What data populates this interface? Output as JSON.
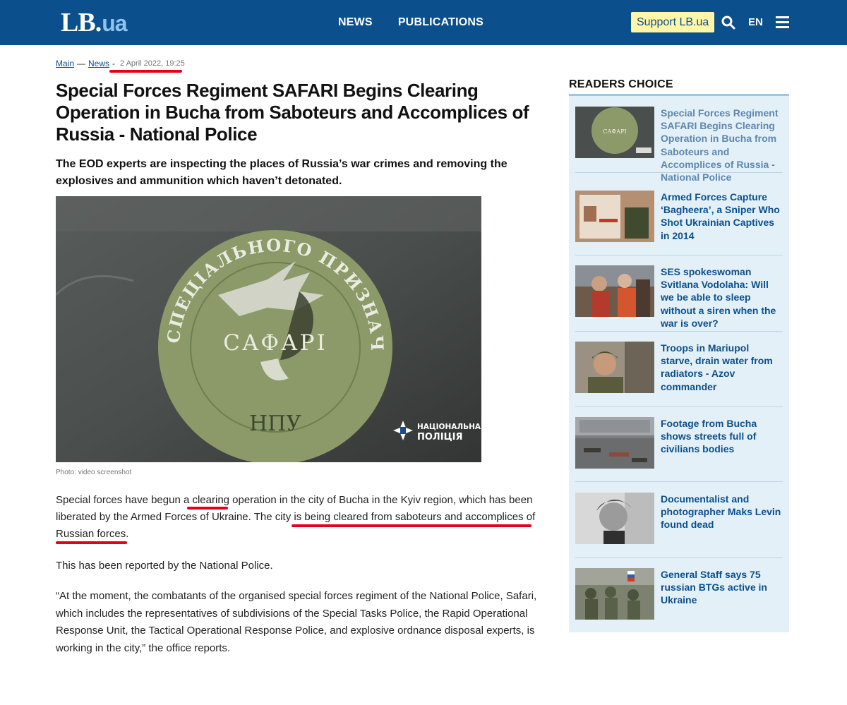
{
  "header": {
    "logo_main": "LB",
    "logo_dot": ".",
    "logo_suffix": "ua",
    "nav": [
      "NEWS",
      "PUBLICATIONS"
    ],
    "support_label": "Support LB.ua",
    "lang": "EN",
    "search_icon": "search-icon",
    "menu_icon": "hamburger-menu-icon",
    "colors": {
      "bar": "#0b4f8c",
      "support_bg": "#fff6a8"
    }
  },
  "breadcrumb": {
    "home": "Main",
    "sep1": "—",
    "section": "News",
    "sep2": "-",
    "date": "2 April 2022, 19:25"
  },
  "article": {
    "title": "Special Forces Regiment SAFARI Begins Clearing Operation in Bucha from Saboteurs and Accomplices of Russia - National Police",
    "lead": "The EOD experts are inspecting the places of Russia’s war crimes and removing the explosives and ammunition which haven’t detonated.",
    "photo": {
      "emblem_top": "ПОЛК СПЕЦІАЛЬНОГО ПРИЗНАЧЕННЯ",
      "emblem_name": "САФАРІ",
      "emblem_bottom": "НПУ",
      "watermark_line1": "НАЦІОНАЛЬНА",
      "watermark_line2": "ПОЛІЦІЯ"
    },
    "photo_caption": "Photo: video screenshot",
    "p1": {
      "a": "Special forces have begun a ",
      "b": "clearing",
      "c": " operation in the city of Bucha in the Kyiv region, which has been liberated by the Armed Forces of Ukraine. The city ",
      "d": "is being cleared from saboteurs and accomplices of Russian forces",
      "e": "."
    },
    "p2": "This has been reported by the National Police.",
    "p3": "“At the moment, the combatants of the organised special forces regiment of the National Police, Safari, which includes the representatives of subdivisions of the Special Tasks Police, the Rapid Operational Response Unit, the Tactical Operational Response Police, and explosive ordnance disposal experts, is working in the city,” the office reports."
  },
  "sidebar": {
    "title": "READERS CHOICE",
    "items": [
      {
        "title": "Special Forces Regiment SAFARI Begins Clearing Operation in Bucha from Saboteurs and Accomplices of Russia - National Police"
      },
      {
        "title": "Armed Forces Capture ‘Bagheera’, a Sniper Who Shot Ukrainian Captives in 2014"
      },
      {
        "title": "SES spokeswoman Svitlana Vodolaha: Will we be able to sleep without a siren when the war is over?"
      },
      {
        "title": "Troops in Mariupol starve, drain water from radiators - Azov commander"
      },
      {
        "title": "Footage from Bucha shows streets full of civilians bodies"
      },
      {
        "title": "Documentalist and photographer Maks Levin found dead"
      },
      {
        "title": "General Staff says 75 russian BTGs active in Ukraine"
      }
    ]
  },
  "annotation_color": "#e3001b"
}
